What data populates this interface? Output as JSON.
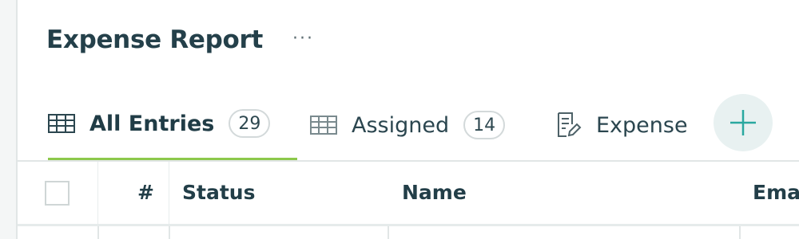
{
  "header": {
    "title": "Expense Report",
    "more_label": "···"
  },
  "tabs": [
    {
      "label": "All Entries",
      "count": "29",
      "icon": "table-icon",
      "active": true
    },
    {
      "label": "Assigned",
      "count": "14",
      "icon": "table-icon",
      "active": false
    },
    {
      "label": "Expense",
      "icon": "form-edit-icon",
      "active": false
    }
  ],
  "add_view": {
    "icon": "plus-icon"
  },
  "table": {
    "columns": [
      "#",
      "Status",
      "Name",
      "Ema"
    ]
  },
  "colors": {
    "accent": "#8cc84b",
    "text": "#24404a",
    "add_bg": "#e8f1f1",
    "add_icon": "#2aa8a0"
  }
}
